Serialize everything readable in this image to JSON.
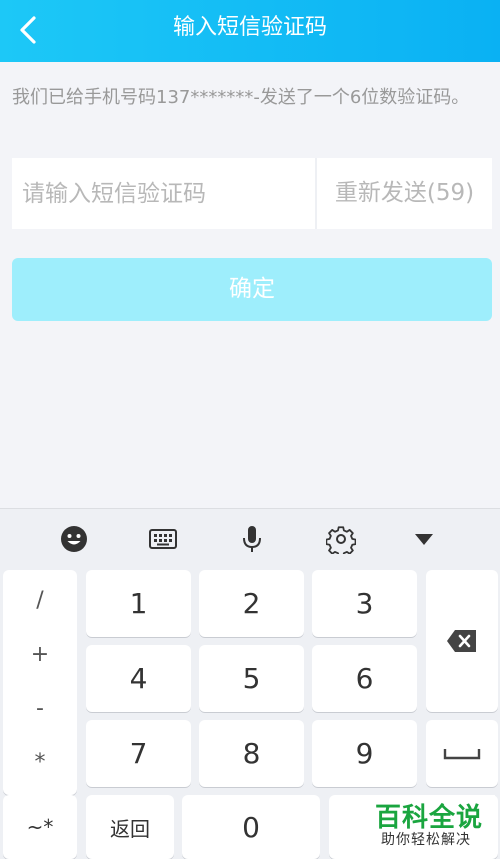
{
  "header": {
    "title": "输入短信验证码",
    "back_icon": "chevron-left-icon"
  },
  "hint": "我们已给手机号码137*******-发送了一个6位数验证码。",
  "form": {
    "code_placeholder": "请输入短信验证码",
    "resend_label": "重新发送(59)",
    "confirm_label": "确定"
  },
  "keyboard": {
    "toolbar": [
      "emoji-icon",
      "keyboard-icon",
      "microphone-icon",
      "settings-icon",
      "collapse-icon"
    ],
    "symbols": [
      "/",
      "+",
      "-",
      "*"
    ],
    "digits": [
      "1",
      "2",
      "3",
      "4",
      "5",
      "6",
      "7",
      "8",
      "9",
      "0"
    ],
    "bottom": {
      "symbols_label": "~*",
      "back_label": "返回"
    },
    "delete_icon": "backspace-icon",
    "space_icon": "space-icon"
  },
  "watermark": {
    "big": "百科全说",
    "small": "助你轻松解决"
  },
  "colors": {
    "header": "#0ab1f3",
    "confirm_disabled": "#9eeefc",
    "watermark": "#1aa53f"
  }
}
